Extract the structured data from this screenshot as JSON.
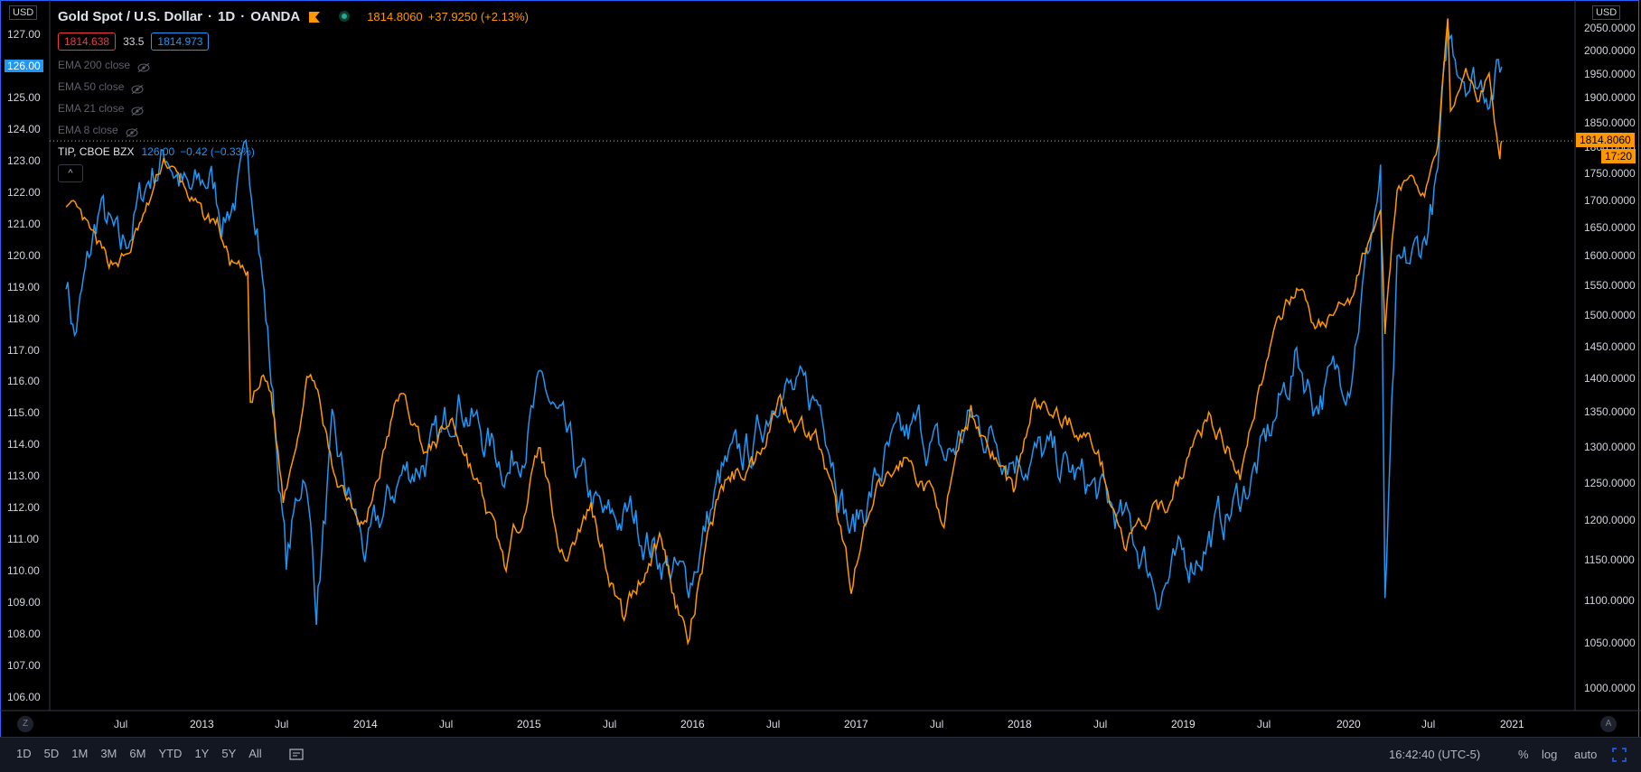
{
  "header": {
    "symbol": "Gold Spot / U.S. Dollar",
    "interval": "1D",
    "exchange": "OANDA",
    "sep": "·",
    "last_price": "1814.8060",
    "change": "+37.9250 (+2.13%)",
    "bid": "1814.638",
    "spread": "33.5",
    "ask": "1814.973"
  },
  "indicators": [
    "EMA 200 close",
    "EMA 50 close",
    "EMA 21 close",
    "EMA 8 close"
  ],
  "compare": {
    "symbol": "TIP, CBOE BZX",
    "value": "126.00",
    "change": "−0.42 (−0.33%)"
  },
  "collapse_button": "^",
  "left_axis": {
    "currency": "USD",
    "ticks": [
      "127.00",
      "126.00",
      "125.00",
      "124.00",
      "123.00",
      "122.00",
      "121.00",
      "120.00",
      "119.00",
      "118.00",
      "117.00",
      "116.00",
      "115.00",
      "114.00",
      "113.00",
      "112.00",
      "111.00",
      "110.00",
      "109.00",
      "108.00",
      "107.00",
      "106.00"
    ],
    "highlight": "126.00"
  },
  "right_axis": {
    "currency": "USD",
    "ticks": [
      "2050.0000",
      "2000.0000",
      "1950.0000",
      "1900.0000",
      "1850.0000",
      "1800.0000",
      "1750.0000",
      "1700.0000",
      "1650.0000",
      "1600.0000",
      "1550.0000",
      "1500.0000",
      "1450.0000",
      "1400.0000",
      "1350.0000",
      "1300.0000",
      "1250.0000",
      "1200.0000",
      "1150.0000",
      "1100.0000",
      "1050.0000",
      "1000.0000"
    ],
    "price_label": "1814.8060",
    "countdown": "17:20"
  },
  "time_axis": [
    "Jul",
    "2013",
    "Jul",
    "2014",
    "Jul",
    "2015",
    "Jul",
    "2016",
    "Jul",
    "2017",
    "Jul",
    "2018",
    "Jul",
    "2019",
    "Jul",
    "2020",
    "Jul",
    "2021"
  ],
  "corner_left": "Z",
  "corner_right": "A",
  "toolbar": {
    "ranges": [
      "1D",
      "5D",
      "1M",
      "3M",
      "6M",
      "YTD",
      "1Y",
      "5Y",
      "All"
    ],
    "time": "16:42:40 (UTC-5)",
    "percent": "%",
    "log": "log",
    "auto": "auto"
  },
  "colors": {
    "gold": "#ff9800",
    "tip": "#2196f3",
    "background": "#000000",
    "accent": "#2962ff"
  },
  "chart_data": {
    "type": "line",
    "x_range": [
      "2012-03",
      "2020-12"
    ],
    "series": [
      {
        "name": "Gold Spot / U.S. Dollar",
        "axis": "right",
        "color": "#ff9800",
        "points": [
          [
            "2012-03-01",
            1700
          ],
          [
            "2012-04-15",
            1650
          ],
          [
            "2012-06-01",
            1590
          ],
          [
            "2012-07-15",
            1600
          ],
          [
            "2012-09-01",
            1690
          ],
          [
            "2012-10-05",
            1780
          ],
          [
            "2012-11-15",
            1730
          ],
          [
            "2012-12-31",
            1670
          ],
          [
            "2013-02-01",
            1660
          ],
          [
            "2013-03-01",
            1590
          ],
          [
            "2013-04-10",
            1560
          ],
          [
            "2013-04-16",
            1360
          ],
          [
            "2013-05-15",
            1400
          ],
          [
            "2013-06-01",
            1380
          ],
          [
            "2013-06-28",
            1230
          ],
          [
            "2013-08-28",
            1420
          ],
          [
            "2013-10-15",
            1270
          ],
          [
            "2013-12-31",
            1200
          ],
          [
            "2014-03-15",
            1380
          ],
          [
            "2014-05-15",
            1290
          ],
          [
            "2014-07-10",
            1340
          ],
          [
            "2014-09-15",
            1230
          ],
          [
            "2014-11-07",
            1140
          ],
          [
            "2015-01-22",
            1300
          ],
          [
            "2015-03-15",
            1150
          ],
          [
            "2015-05-15",
            1220
          ],
          [
            "2015-07-24",
            1080
          ],
          [
            "2015-10-15",
            1180
          ],
          [
            "2015-12-17",
            1050
          ],
          [
            "2016-03-01",
            1250
          ],
          [
            "2016-05-15",
            1280
          ],
          [
            "2016-07-06",
            1370
          ],
          [
            "2016-08-15",
            1340
          ],
          [
            "2016-10-01",
            1310
          ],
          [
            "2016-12-15",
            1125
          ],
          [
            "2017-02-15",
            1240
          ],
          [
            "2017-04-15",
            1285
          ],
          [
            "2017-07-10",
            1210
          ],
          [
            "2017-09-08",
            1350
          ],
          [
            "2017-12-12",
            1240
          ],
          [
            "2018-01-25",
            1360
          ],
          [
            "2018-04-15",
            1340
          ],
          [
            "2018-06-15",
            1300
          ],
          [
            "2018-08-16",
            1170
          ],
          [
            "2018-11-15",
            1220
          ],
          [
            "2019-02-20",
            1345
          ],
          [
            "2019-05-01",
            1270
          ],
          [
            "2019-06-25",
            1420
          ],
          [
            "2019-09-04",
            1555
          ],
          [
            "2019-10-15",
            1480
          ],
          [
            "2019-12-31",
            1520
          ],
          [
            "2020-03-09",
            1700
          ],
          [
            "2020-03-19",
            1470
          ],
          [
            "2020-04-15",
            1730
          ],
          [
            "2020-06-15",
            1720
          ],
          [
            "2020-07-15",
            1810
          ],
          [
            "2020-08-06",
            2070
          ],
          [
            "2020-08-12",
            1860
          ],
          [
            "2020-09-15",
            1960
          ],
          [
            "2020-10-15",
            1900
          ],
          [
            "2020-11-06",
            1950
          ],
          [
            "2020-11-30",
            1775
          ],
          [
            "2020-12-04",
            1814.806
          ]
        ]
      },
      {
        "name": "TIP, CBOE BZX",
        "axis": "left",
        "color": "#2196f3",
        "points": [
          [
            "2012-03-01",
            119.5
          ],
          [
            "2012-03-20",
            117.5
          ],
          [
            "2012-05-15",
            121.5
          ],
          [
            "2012-07-01",
            120
          ],
          [
            "2012-09-01",
            122.5
          ],
          [
            "2012-10-15",
            123.3
          ],
          [
            "2012-12-01",
            121.8
          ],
          [
            "2013-01-15",
            122.5
          ],
          [
            "2013-02-15",
            121.3
          ],
          [
            "2013-04-10",
            122.7
          ],
          [
            "2013-05-01",
            121.5
          ],
          [
            "2013-06-05",
            115.5
          ],
          [
            "2013-07-05",
            110.2
          ],
          [
            "2013-08-15",
            113.5
          ],
          [
            "2013-09-10",
            109
          ],
          [
            "2013-10-15",
            114
          ],
          [
            "2013-12-31",
            110.5
          ],
          [
            "2014-03-15",
            113
          ],
          [
            "2014-06-15",
            114
          ],
          [
            "2014-07-20",
            115.8
          ],
          [
            "2014-09-15",
            114.3
          ],
          [
            "2014-11-15",
            113.3
          ],
          [
            "2015-01-30",
            115.8
          ],
          [
            "2015-04-15",
            113
          ],
          [
            "2015-06-15",
            111.5
          ],
          [
            "2015-08-15",
            111.8
          ],
          [
            "2015-10-15",
            110.5
          ],
          [
            "2015-12-15",
            109.5
          ],
          [
            "2016-03-01",
            113
          ],
          [
            "2016-05-15",
            114
          ],
          [
            "2016-07-08",
            116.2
          ],
          [
            "2016-08-15",
            115.5
          ],
          [
            "2016-10-15",
            115.3
          ],
          [
            "2016-12-15",
            111.2
          ],
          [
            "2017-03-01",
            113.5
          ],
          [
            "2017-05-15",
            114.5
          ],
          [
            "2017-07-15",
            113.5
          ],
          [
            "2017-09-08",
            114.8
          ],
          [
            "2017-12-15",
            113.8
          ],
          [
            "2018-03-01",
            113.6
          ],
          [
            "2018-06-15",
            112.5
          ],
          [
            "2018-09-01",
            111.2
          ],
          [
            "2018-11-01",
            109.5
          ],
          [
            "2019-01-15",
            110.5
          ],
          [
            "2019-04-15",
            112
          ],
          [
            "2019-06-15",
            113.5
          ],
          [
            "2019-09-04",
            116.8
          ],
          [
            "2019-10-15",
            115.5
          ],
          [
            "2019-12-31",
            116.5
          ],
          [
            "2020-03-09",
            122.5
          ],
          [
            "2020-03-19",
            108.8
          ],
          [
            "2020-04-15",
            119
          ],
          [
            "2020-06-15",
            120.5
          ],
          [
            "2020-07-15",
            122.5
          ],
          [
            "2020-08-06",
            126.8
          ],
          [
            "2020-09-15",
            126
          ],
          [
            "2020-10-15",
            125.5
          ],
          [
            "2020-11-15",
            125.6
          ],
          [
            "2020-12-04",
            126
          ]
        ]
      }
    ],
    "y_left": {
      "label": "USD",
      "range": [
        105.5,
        127.6
      ]
    },
    "y_right": {
      "label": "USD",
      "range": [
        976,
        2083
      ],
      "scale": "log"
    },
    "last_value_line": 1814.806,
    "grid": false
  }
}
